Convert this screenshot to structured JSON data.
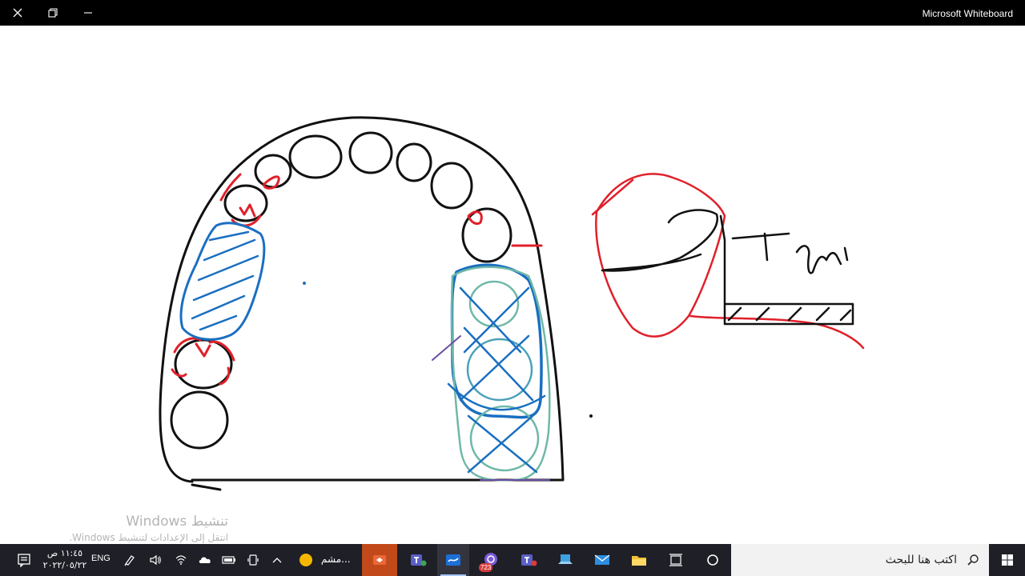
{
  "window": {
    "title": "Microsoft Whiteboard"
  },
  "watermark": {
    "title": "تنشيط Windows",
    "subtitle": "انتقل إلى الإعدادات لتنشيط Windows."
  },
  "taskbar": {
    "clock_time": "١١:٤٥ ص",
    "clock_date": "٢٠٢٢/٠٥/٢٢",
    "language": "ENG",
    "running_app_label": "مشم...",
    "search_placeholder": "اكتب هنا للبحث",
    "badge_count": "723"
  },
  "colors": {
    "stroke_black": "#111111",
    "stroke_red": "#e0202a",
    "stroke_blue": "#1a6fc0",
    "stroke_teal": "#6fb8a8",
    "taskbar_bg": "#1f1f27"
  }
}
